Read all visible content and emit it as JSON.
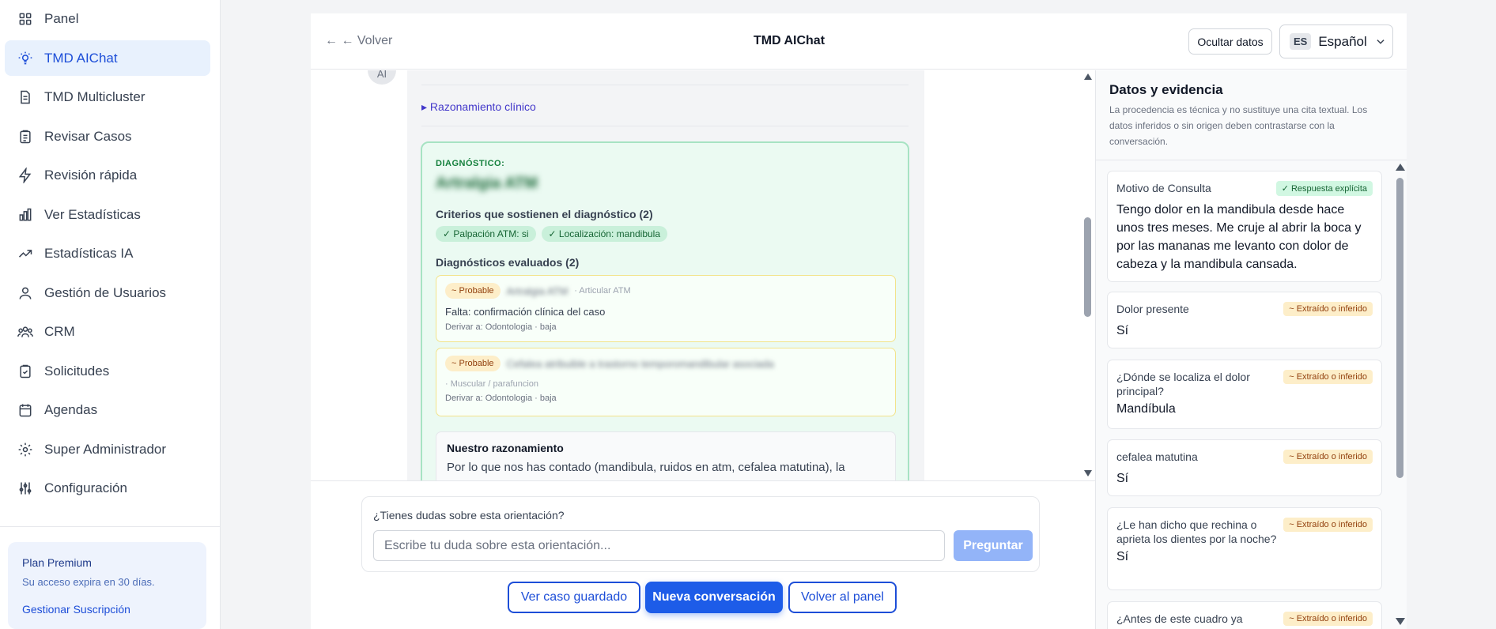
{
  "sidebar": {
    "items": [
      {
        "label": "Panel",
        "icon": "grid-icon"
      },
      {
        "label": "TMD AIChat",
        "icon": "lightbulb-icon",
        "active": true
      },
      {
        "label": "TMD Multicluster",
        "icon": "document-icon"
      },
      {
        "label": "Revisar Casos",
        "icon": "clipboard-icon"
      },
      {
        "label": "Revisión rápida",
        "icon": "lightning-icon"
      },
      {
        "label": "Ver Estadísticas",
        "icon": "bar-chart-icon"
      },
      {
        "label": "Estadísticas IA",
        "icon": "trending-up-icon"
      },
      {
        "label": "Gestión de Usuarios",
        "icon": "users-icon"
      },
      {
        "label": "CRM",
        "icon": "group-icon"
      },
      {
        "label": "Solicitudes",
        "icon": "clipboard-check-icon"
      },
      {
        "label": "Agendas",
        "icon": "calendar-icon"
      },
      {
        "label": "Super Administrador",
        "icon": "gear-icon"
      },
      {
        "label": "Configuración",
        "icon": "sliders-icon"
      }
    ],
    "plan": {
      "title": "Plan Premium",
      "subtitle": "Su acceso expira en 30 días.",
      "link": "Gestionar Suscripción"
    }
  },
  "header": {
    "back": "← ← Volver",
    "title": "TMD AIChat",
    "hide_data": "Ocultar datos",
    "lang_code": "ES",
    "lang_name": "Español"
  },
  "chat": {
    "avatar": "AI",
    "reasoning_toggle": "▸ Razonamiento clínico",
    "diagnosis_label": "DIAGNÓSTICO:",
    "diagnosis_name": "Artralgia ATM",
    "criteria_title": "Criterios que sostienen el diagnóstico (2)",
    "criteria": [
      "✓ Palpación ATM: si",
      "✓ Localización: mandibula"
    ],
    "evaluated_title": "Diagnósticos evaluados (2)",
    "evaluated": [
      {
        "badge": "~ Probable",
        "name": "Artralgia ATM",
        "category": "· Articular ATM",
        "missing": "Falta: confirmación clínica del caso",
        "derive": "Derivar a: Odontologia · baja"
      },
      {
        "badge": "~ Probable",
        "name": "Cefalea atribuible a trastorno temporomandibular asociada",
        "category": "· Muscular / parafuncion",
        "derive": "Derivar a: Odontologia · baja"
      }
    ],
    "reason_title": "Nuestro razonamiento",
    "reason_text": "Por lo que nos has contado (mandibula, ruidos en atm, cefalea matutina), la"
  },
  "ask": {
    "label": "¿Tienes dudas sobre esta orientación?",
    "placeholder": "Escribe tu duda sobre esta orientación...",
    "button": "Preguntar"
  },
  "actions": {
    "saved_case": "Ver caso guardado",
    "new_conversation": "Nueva conversación",
    "back_to_panel": "Volver al panel"
  },
  "evidence": {
    "title": "Datos y evidencia",
    "description": "La procedencia es técnica y no sustituye una cita textual. Los datos inferidos o sin origen deben contrastarse con la conversación.",
    "cards": [
      {
        "label": "Motivo de Consulta",
        "badge": "✓ Respuesta explícita",
        "type": "explicit",
        "value": "Tengo dolor en la mandibula desde hace unos tres meses. Me cruje al abrir la boca y por las mananas me levanto con dolor de cabeza y la mandibula cansada."
      },
      {
        "label": "Dolor presente",
        "badge": "~ Extraído o inferido",
        "type": "inferred",
        "value": "Sí"
      },
      {
        "label": "¿Dónde se localiza el dolor principal?",
        "badge": "~ Extraído o inferido",
        "type": "inferred",
        "value": "Mandíbula"
      },
      {
        "label": "cefalea matutina",
        "badge": "~ Extraído o inferido",
        "type": "inferred",
        "value": "Sí"
      },
      {
        "label": "¿Le han dicho que rechina o aprieta los dientes por la noche?",
        "badge": "~ Extraído o inferido",
        "type": "inferred",
        "value": "Sí"
      },
      {
        "label": "¿Antes de este cuadro ya",
        "badge": "~ Extraído o inferido",
        "type": "inferred",
        "value": ""
      }
    ]
  },
  "colors": {
    "accent": "#1d5ce8",
    "active_nav_bg": "#e8f1fd",
    "success": "#166534",
    "warning": "#92400e"
  }
}
